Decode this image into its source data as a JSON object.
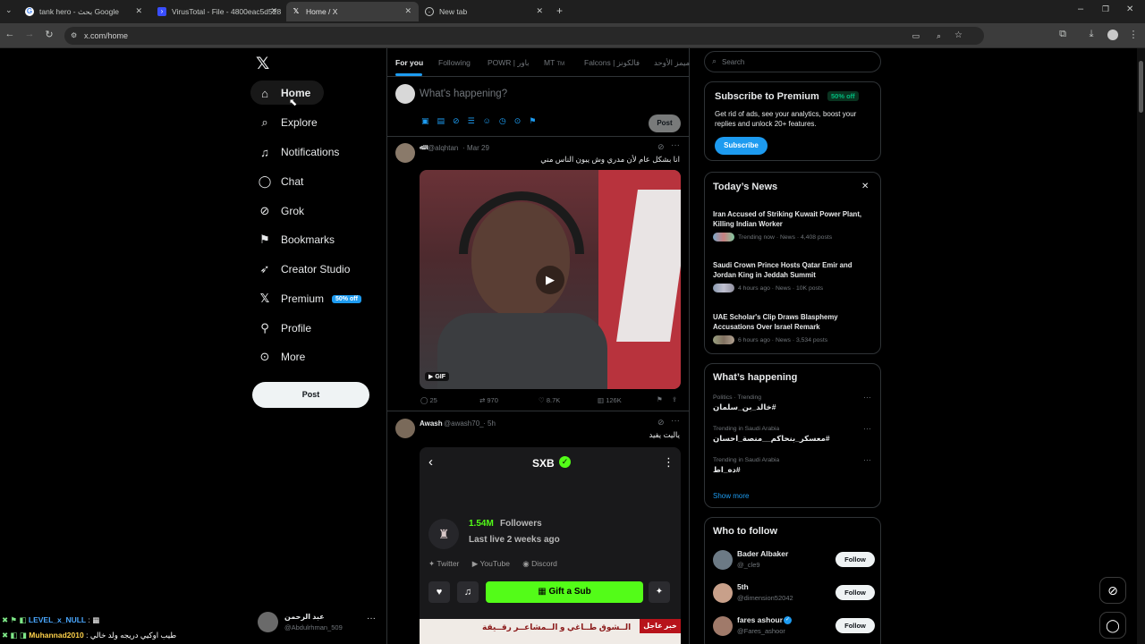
{
  "browser": {
    "tabs": [
      {
        "label": "tank hero - بحث Google",
        "icon": "google-icon"
      },
      {
        "label": "VirusTotal - File - 4800eac5d528",
        "icon": "virustotal-icon"
      },
      {
        "label": "Home / X",
        "icon": "x-logo-icon"
      },
      {
        "label": "New tab",
        "icon": "globe-icon"
      }
    ],
    "url": "x.com/home"
  },
  "nav": {
    "items": [
      {
        "label": "Home",
        "icon": "home-icon"
      },
      {
        "label": "Explore",
        "icon": "search-icon"
      },
      {
        "label": "Notifications",
        "icon": "bell-icon"
      },
      {
        "label": "Chat",
        "icon": "chat-icon"
      },
      {
        "label": "Grok",
        "icon": "grok-icon"
      },
      {
        "label": "Bookmarks",
        "icon": "bookmark-icon"
      },
      {
        "label": "Creator Studio",
        "icon": "rocket-icon"
      },
      {
        "label": "Premium",
        "icon": "x-logo-icon"
      },
      {
        "label": "Profile",
        "icon": "person-icon"
      },
      {
        "label": "More",
        "icon": "more-circle-icon"
      }
    ],
    "premium_badge": "50% off",
    "post_button": "Post",
    "account": {
      "name": "عبد الرحمن",
      "handle": "@Abdulrhman_509"
    }
  },
  "feed": {
    "tabs": [
      "For you",
      "Following",
      "POWR | باور",
      "MT",
      "Falcons | فالكونز",
      "ميمز الأوحد"
    ],
    "tab_mt_suffix": "TM",
    "composer": {
      "placeholder": "What's happening?",
      "post_label": "Post"
    },
    "post1": {
      "name": "",
      "handle": "@alqhtan",
      "date": "Mar 29",
      "text": "انا بشكل عام لأن مدري وش يبون الناس مني",
      "media_badge": "GIF",
      "stats": {
        "replies": "25",
        "reposts": "970",
        "likes": "8.7K",
        "views": "126K"
      }
    },
    "post2": {
      "name": "Awash",
      "handle": "@awash70_",
      "date": "5h",
      "text": "ياليت يفيد",
      "embed": {
        "title": "SXB",
        "followers_count": "1.54M",
        "followers_label": "Followers",
        "last_live": "Last live 2 weeks ago",
        "links": [
          "Twitter",
          "YouTube",
          "Discord"
        ],
        "gift": "Gift a Sub",
        "banner_text": "الــشوق طــاغي و الــمشاعــر رقــيقة",
        "banner_tag": "خبر عاجل"
      }
    }
  },
  "sidebar": {
    "search_placeholder": "Search",
    "premium": {
      "title": "Subscribe to Premium",
      "badge": "50% off",
      "text": "Get rid of ads, see your analytics, boost your replies and unlock 20+ features.",
      "button": "Subscribe"
    },
    "news": {
      "title": "Today’s News",
      "items": [
        {
          "headline": "Iran Accused of Striking Kuwait Power Plant, Killing Indian Worker",
          "meta": "Trending now · News · 4,408 posts"
        },
        {
          "headline": "Saudi Crown Prince Hosts Qatar Emir and Jordan King in Jeddah Summit",
          "meta": "4 hours ago · News · 10K posts"
        },
        {
          "headline": "UAE Scholar's Clip Draws Blasphemy Accusations Over Israel Remark",
          "meta": "6 hours ago · News · 3,534 posts"
        }
      ]
    },
    "happening": {
      "title": "What’s happening",
      "items": [
        {
          "context": "Politics · Trending",
          "tag": "#خالد_بن_سلمان"
        },
        {
          "context": "Trending in Saudi Arabia",
          "tag": "#معسكر_بنحاكم__منصة_احسان"
        },
        {
          "context": "Trending in Saudi Arabia",
          "tag": "#ده_اط"
        }
      ],
      "show_more": "Show more"
    },
    "who": {
      "title": "Who to follow",
      "follow": "Follow",
      "items": [
        {
          "name": "Bader Albaker",
          "handle": "@_cle9"
        },
        {
          "name": "5th",
          "handle": "@dimension52042"
        },
        {
          "name": "fares ashour",
          "handle": "@Fares_ashoor"
        }
      ]
    }
  },
  "overlay": {
    "chat1_user": "LEVEL_x_NULL",
    "chat2_user": "Muhannad2010",
    "chat2_text": "طيب اوكيي دريجه ولد خالي"
  }
}
